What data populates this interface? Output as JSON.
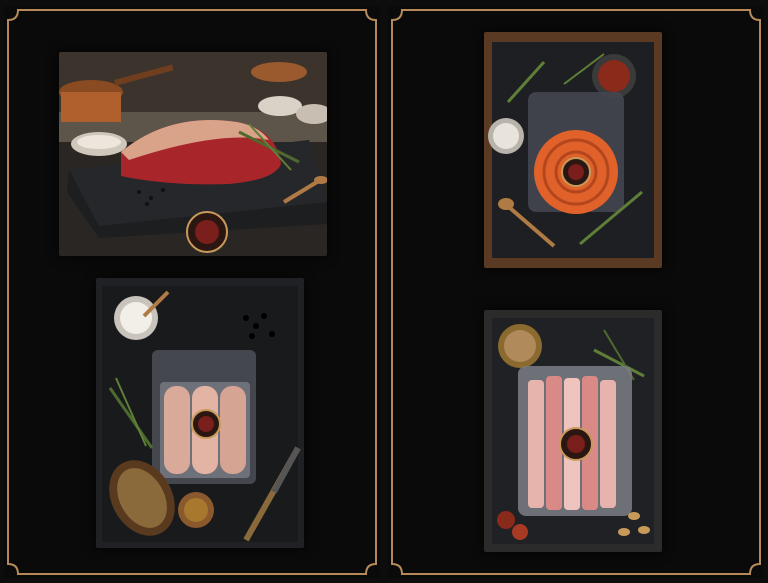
{
  "colors": {
    "background": "#0b0b0b",
    "frame_gold": "#b58a58",
    "slate": "#1e1f22",
    "wood": "#5a3a22",
    "meat_red": "#a8252a",
    "sausage_orange": "#e0622a",
    "bacon_pink": "#e7b3ad"
  },
  "photos": [
    {
      "subject": "beef-steak-on-slate",
      "has_logo": true
    },
    {
      "subject": "orange-spiral-sausage-vacuum-pack",
      "has_logo": true
    },
    {
      "subject": "pale-sausages-vacuum-pack",
      "has_logo": true
    },
    {
      "subject": "sliced-bacon-vacuum-pack",
      "has_logo": true
    }
  ]
}
